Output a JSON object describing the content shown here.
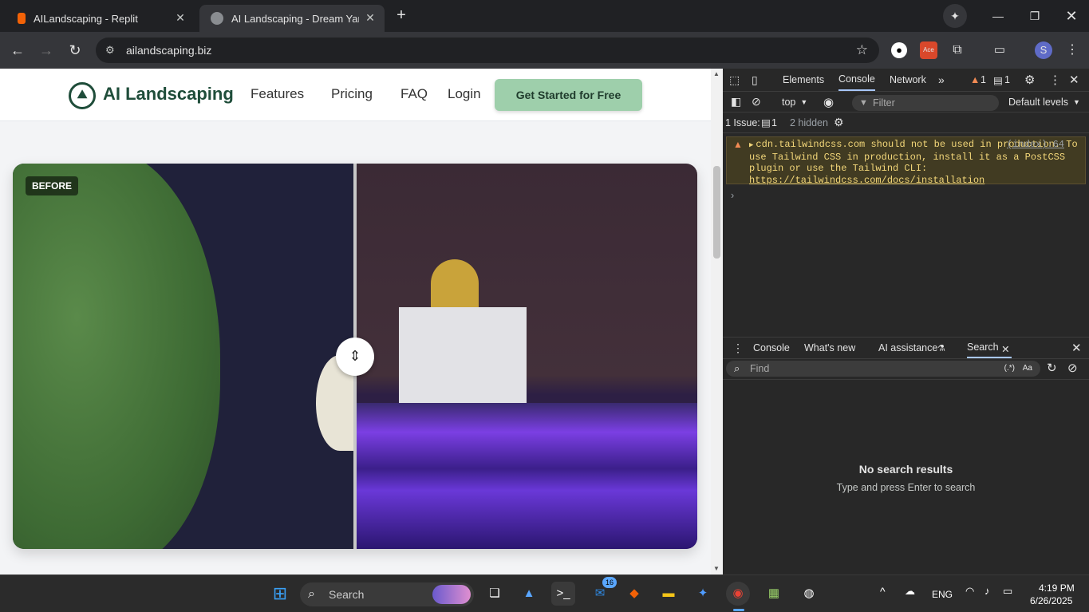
{
  "tabs": [
    {
      "title": "AILandscaping - Replit",
      "active": false
    },
    {
      "title": "AI Landscaping - Dream Yard, I",
      "active": true
    }
  ],
  "address": {
    "url": "ailandscaping.biz"
  },
  "site": {
    "brand": "AI Landscaping",
    "nav": [
      "Features",
      "Pricing",
      "FAQ",
      "Login"
    ],
    "cta": "Get Started for Free",
    "before_label": "BEFORE"
  },
  "devtools": {
    "tabs": [
      "Elements",
      "Console",
      "Network"
    ],
    "warning_count": "1",
    "issue_count": "1",
    "context": "top",
    "filter_placeholder": "Filter",
    "levels": "Default levels",
    "issues_label": "1 Issue:",
    "issues_num": "1",
    "hidden": "2 hidden",
    "warning_text": "cdn.tailwindcss.com should not be used in production. To use Tailwind CSS in production, install it as a PostCSS plugin or use the Tailwind CLI:",
    "warning_source": "(index):64",
    "warning_link": "https://tailwindcss.com/docs/installation",
    "drawer_tabs": [
      "Console",
      "What's new",
      "AI assistance",
      "Search"
    ],
    "find_placeholder": "Find",
    "regex": "(.*)",
    "case": "Aa",
    "no_results_title": "No search results",
    "no_results_hint": "Type and press Enter to search"
  },
  "taskbar": {
    "search_placeholder": "Search",
    "mail_badge": "16",
    "lang": "ENG",
    "time": "4:19 PM",
    "date": "6/26/2025"
  },
  "colors": {
    "brand_green": "#1f4d3a",
    "cta_green": "#9ecfab",
    "warn_bg": "#413b22"
  }
}
